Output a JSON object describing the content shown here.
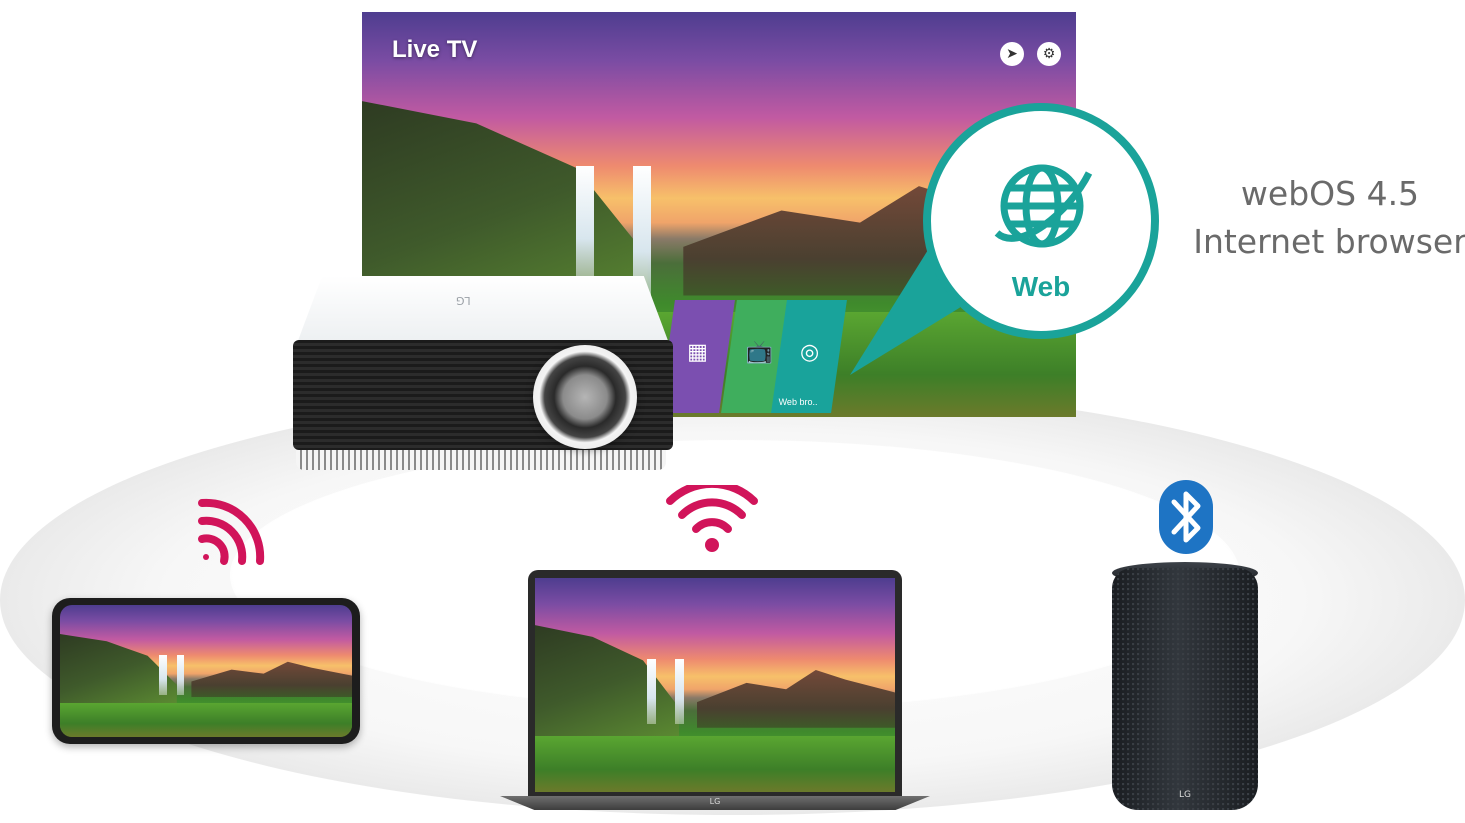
{
  "tv": {
    "title": "Live TV",
    "apps": [
      {
        "name": "photo-video",
        "color": "#7b4fb0"
      },
      {
        "name": "tv-guide",
        "color": "#3fae5d"
      },
      {
        "name": "web-browser",
        "color": "#19a39b",
        "label": "Web bro.."
      }
    ]
  },
  "callout": {
    "label": "Web",
    "accent": "#1aa39a"
  },
  "headline": {
    "line1": "webOS 4.5",
    "line2": "Internet browser"
  },
  "devices": {
    "projector_logo": "LG",
    "laptop_logo": "LG",
    "speaker_logo": "LG"
  },
  "colors": {
    "wifi": "#d1145a",
    "bluetooth": "#1e74c4"
  }
}
